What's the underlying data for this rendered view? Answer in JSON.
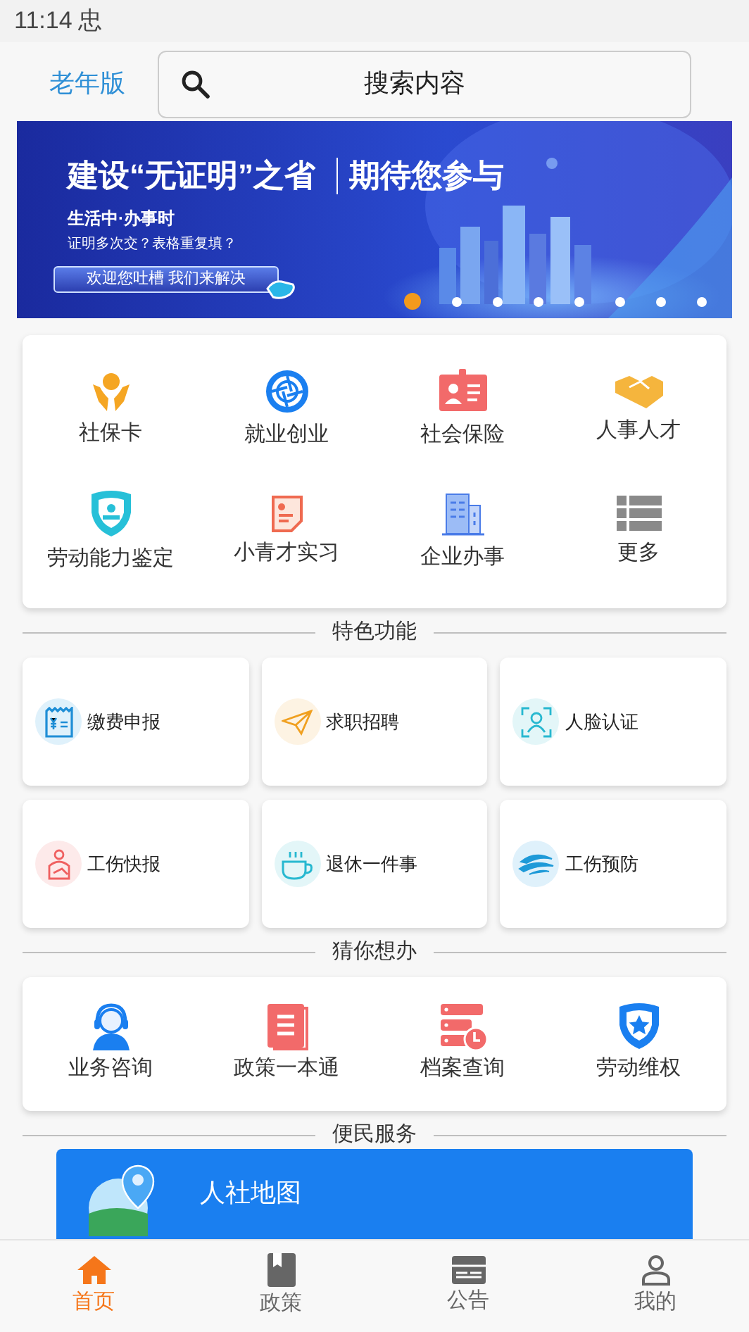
{
  "status_bar": {
    "time": "11:14",
    "notification": "忠"
  },
  "header": {
    "mode_link": "老年版",
    "search": {
      "placeholder": "搜索内容"
    }
  },
  "banner": {
    "title_left": "建设“无证明”之省",
    "title_right": "期待您参与",
    "subtitle": "生活中·办事时",
    "question": "证明多次交？表格重复填？",
    "button": "欢迎您吐槽 我们来解决",
    "slides": [
      {
        "selected": true
      },
      {
        "selected": false
      },
      {
        "selected": false
      },
      {
        "selected": false
      },
      {
        "selected": false
      },
      {
        "selected": false
      },
      {
        "selected": false
      },
      {
        "selected": false
      }
    ]
  },
  "main_services": [
    {
      "label": "社保卡"
    },
    {
      "label": "就业创业"
    },
    {
      "label": "社会保险"
    },
    {
      "label": "人事人才"
    },
    {
      "label": "劳动能力鉴定"
    },
    {
      "label": "小青才实习"
    },
    {
      "label": "企业办事"
    },
    {
      "label": "更多"
    }
  ],
  "featured": {
    "title": "特色功能",
    "items": [
      {
        "label": "缴费申报",
        "color": "#dff1fb"
      },
      {
        "label": "求职招聘",
        "color": "#fdf3e3"
      },
      {
        "label": "人脸认证",
        "color": "#e3f6f8"
      },
      {
        "label": "工伤快报",
        "color": "#fdeaea"
      },
      {
        "label": "退休一件事",
        "color": "#e3f6f8"
      },
      {
        "label": "工伤预防",
        "color": "#dff1fb"
      }
    ]
  },
  "guess": {
    "title": "猜你想办",
    "items": [
      {
        "label": "业务咨询"
      },
      {
        "label": "政策一本通"
      },
      {
        "label": "档案查询"
      },
      {
        "label": "劳动维权"
      }
    ]
  },
  "convenience": {
    "title": "便民服务",
    "card": {
      "title": "人社地图"
    }
  },
  "bottom_nav": [
    {
      "label": "首页",
      "selected": true
    },
    {
      "label": "政策",
      "selected": false
    },
    {
      "label": "公告",
      "selected": false
    },
    {
      "label": "我的",
      "selected": false
    }
  ]
}
